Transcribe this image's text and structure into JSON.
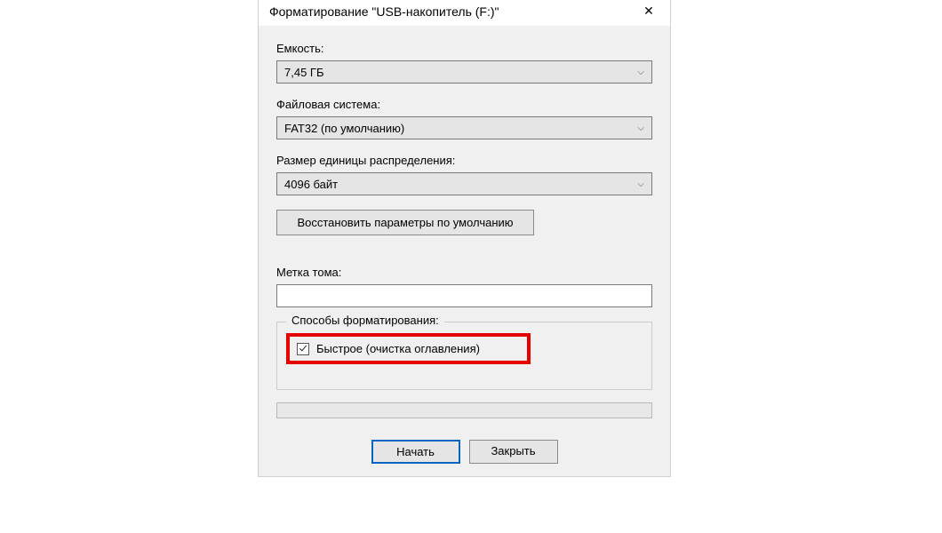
{
  "title": "Форматирование \"USB-накопитель (F:)\"",
  "labels": {
    "capacity": "Емкость:",
    "filesystem": "Файловая система:",
    "allocation": "Размер единицы распределения:",
    "volume": "Метка тома:",
    "methods": "Способы форматирования:"
  },
  "values": {
    "capacity": "7,45 ГБ",
    "filesystem": "FAT32 (по умолчанию)",
    "allocation": "4096 байт",
    "volume": ""
  },
  "buttons": {
    "restore": "Восстановить параметры по умолчанию",
    "start": "Начать",
    "close": "Закрыть"
  },
  "checkbox": {
    "quick": "Быстрое (очистка оглавления)"
  }
}
